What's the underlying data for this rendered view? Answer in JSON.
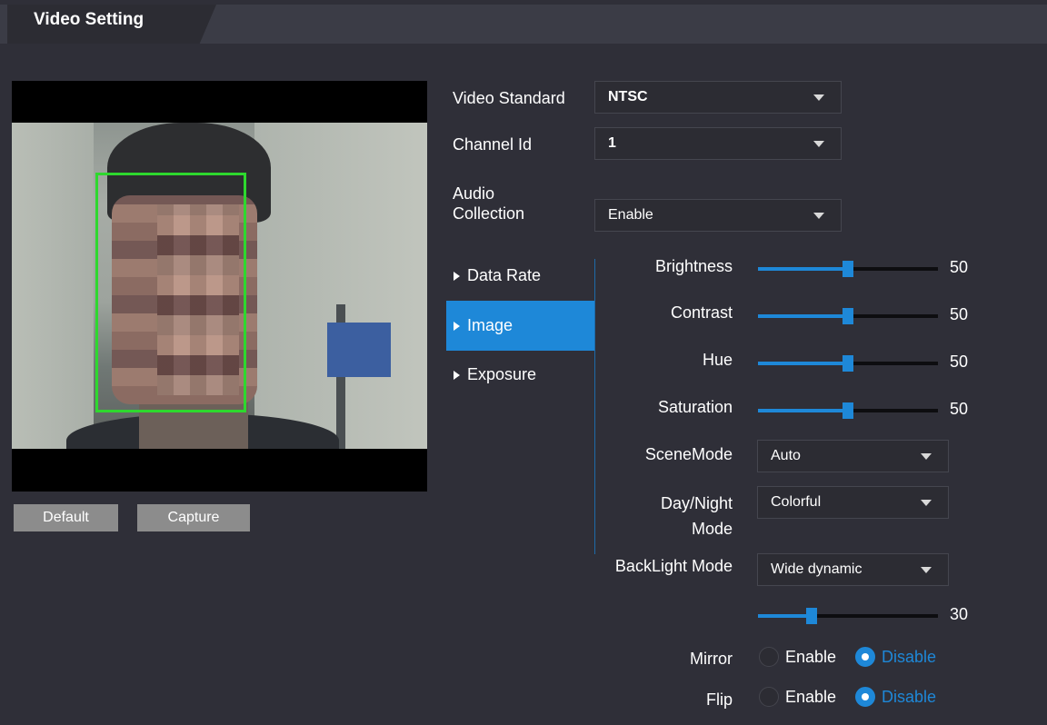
{
  "header": {
    "tab_title": "Video Setting"
  },
  "preview": {
    "default_label": "Default",
    "capture_label": "Capture"
  },
  "form": {
    "video_standard": {
      "label": "Video Standard",
      "value": "NTSC"
    },
    "channel_id": {
      "label": "Channel Id",
      "value": "1"
    },
    "audio_collection": {
      "label_line1": "Audio",
      "label_line2": "Collection",
      "value": "Enable"
    }
  },
  "nav": {
    "items": [
      {
        "label": "Data Rate",
        "active": false
      },
      {
        "label": "Image",
        "active": true
      },
      {
        "label": "Exposure",
        "active": false
      }
    ]
  },
  "image": {
    "brightness": {
      "label": "Brightness",
      "value": 50
    },
    "contrast": {
      "label": "Contrast",
      "value": 50
    },
    "hue": {
      "label": "Hue",
      "value": 50
    },
    "saturation": {
      "label": "Saturation",
      "value": 50
    },
    "scene_mode": {
      "label": "SceneMode",
      "value": "Auto"
    },
    "day_night_mode": {
      "label_line1": "Day/Night",
      "label_line2": "Mode",
      "value": "Colorful"
    },
    "backlight_mode": {
      "label": "BackLight Mode",
      "value": "Wide dynamic",
      "level": 30
    },
    "mirror": {
      "label": "Mirror",
      "enable_label": "Enable",
      "disable_label": "Disable",
      "selected": "Disable"
    },
    "flip": {
      "label": "Flip",
      "enable_label": "Enable",
      "disable_label": "Disable",
      "selected": "Disable"
    }
  },
  "colors": {
    "accent": "#1e88d8",
    "background": "#2f2f38",
    "face_box": "#2ed82e"
  }
}
